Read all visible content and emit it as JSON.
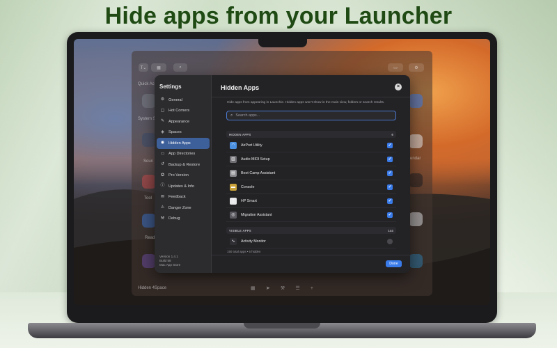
{
  "headline": "Hide apps from your Launcher",
  "background_launcher": {
    "left_labels": [
      "Quick Acce",
      "System S",
      "Soun",
      "Tool",
      "Read"
    ],
    "right_labels": [
      "endar"
    ],
    "bottom_left": "Hidden  4Space"
  },
  "settings": {
    "title": "Settings",
    "sidebar_items": [
      {
        "label": "General",
        "icon": "gear-icon",
        "glyph": "⚙"
      },
      {
        "label": "Hot Corners",
        "icon": "corners-icon",
        "glyph": "▢"
      },
      {
        "label": "Appearance",
        "icon": "paintbrush-icon",
        "glyph": "✎"
      },
      {
        "label": "Spaces",
        "icon": "stack-icon",
        "glyph": "◈"
      },
      {
        "label": "Hidden Apps",
        "icon": "eye-slash-icon",
        "glyph": "◉",
        "active": true
      },
      {
        "label": "App Directories",
        "icon": "folder-icon",
        "glyph": "▭"
      },
      {
        "label": "Backup & Restore",
        "icon": "restore-icon",
        "glyph": "↺"
      },
      {
        "label": "Pro Version",
        "icon": "star-icon",
        "glyph": "✪"
      },
      {
        "label": "Updates & Info",
        "icon": "info-icon",
        "glyph": "ⓘ"
      },
      {
        "label": "Feedback",
        "icon": "envelope-icon",
        "glyph": "✉"
      },
      {
        "label": "Danger Zone",
        "icon": "warning-icon",
        "glyph": "⚠"
      },
      {
        "label": "Debug",
        "icon": "hammer-icon",
        "glyph": "⚒"
      }
    ],
    "version_lines": [
      "Version 1.4.1",
      "Build 58",
      "Mac App Store"
    ]
  },
  "hidden_apps": {
    "title": "Hidden Apps",
    "close_glyph": "×",
    "description": "Hide apps from appearing in Launchie. Hidden apps won't show in the main view, folders or search results.",
    "search_placeholder": "Search apps...",
    "hidden_section": {
      "label": "HIDDEN APPS",
      "count": "6"
    },
    "hidden_list": [
      {
        "name": "AirPort Utility",
        "icon": "wifi-icon",
        "glyph": "◠",
        "color": "#4a8fe0",
        "checked": true
      },
      {
        "name": "Audio MIDI Setup",
        "icon": "midi-icon",
        "glyph": "▥",
        "color": "#6d6d72",
        "checked": true
      },
      {
        "name": "Boot Camp Assistant",
        "icon": "bootcamp-icon",
        "glyph": "▤",
        "color": "#8b8b90",
        "checked": true
      },
      {
        "name": "Console",
        "icon": "console-icon",
        "glyph": "▬",
        "color": "#c9a23a",
        "checked": true
      },
      {
        "name": "HP Smart",
        "icon": "document-icon",
        "glyph": "▯",
        "color": "#e9e9ec",
        "checked": true
      },
      {
        "name": "Migration Assistant",
        "icon": "migration-icon",
        "glyph": "◎",
        "color": "#5a5a60",
        "checked": true
      }
    ],
    "visible_section": {
      "label": "VISIBLE APPS",
      "count": "144"
    },
    "visible_list": [
      {
        "name": "Activity Monitor",
        "icon": "activity-monitor-icon",
        "glyph": "∿",
        "color": "#2f2f33",
        "checked": false
      }
    ],
    "footer_total": "150 total apps  •  6 hidden",
    "done_label": "Done"
  },
  "colors": {
    "headline": "#1f4a14",
    "accent": "#3a7bea",
    "sidebar_active": "#3d5f9a"
  }
}
